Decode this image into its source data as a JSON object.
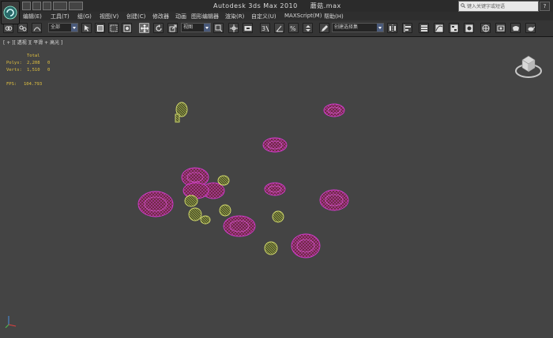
{
  "title": {
    "app": "Autodesk 3ds Max  2010",
    "file": "蘑菇.max"
  },
  "search": {
    "placeholder": "键入关键字或短语"
  },
  "help_label": "?",
  "menu": [
    "编辑(E)",
    "工具(T)",
    "组(G)",
    "视图(V)",
    "创建(C)",
    "修改器",
    "动画",
    "图形编辑器",
    "渲染(R)",
    "自定义(U)",
    "MAXScript(M)",
    "帮助(H)"
  ],
  "toolbar": {
    "selection_filter": "全部",
    "reference_coord": "视图",
    "named_selection": "创建选择集"
  },
  "viewport": {
    "label": "[ + ][ 透视 ][ 平滑 + 高光 ]",
    "stats": {
      "header": "Total",
      "polys_label": "Polys:",
      "polys_total": "2,208",
      "polys_sel": "0",
      "verts_label": "Verts:",
      "verts_total": "1,510",
      "verts_sel": "0",
      "fps_label": "FPS:",
      "fps_value": "104.793"
    }
  },
  "colors": {
    "viewport_bg": "#444444",
    "mushroom_cap_wire": "#d63ccf",
    "mushroom_cap_fill": "#6a2a3a",
    "mushroom_small_wire": "#d8e070",
    "stats_text": "#e0c040"
  },
  "icons": [
    "app-logo-icon",
    "new-file-icon",
    "open-file-icon",
    "save-file-icon",
    "undo-icon",
    "redo-icon",
    "link-icon",
    "unlink-icon",
    "bind-space-warp-icon",
    "select-object-icon",
    "select-by-name-icon",
    "rectangle-selection-icon",
    "window-crossing-icon",
    "move-icon",
    "rotate-icon",
    "scale-icon",
    "pivot-center-icon",
    "manipulate-icon",
    "snap-icon",
    "angle-snap-icon",
    "percent-snap-icon",
    "spinner-snap-icon",
    "edit-named-selection-icon",
    "mirror-icon",
    "align-icon",
    "layer-manager-icon",
    "curve-editor-icon",
    "schematic-view-icon",
    "material-editor-icon",
    "render-setup-icon",
    "rendered-frame-icon",
    "render-icon",
    "viewcube-icon",
    "axis-tripod-icon",
    "search-icon"
  ]
}
